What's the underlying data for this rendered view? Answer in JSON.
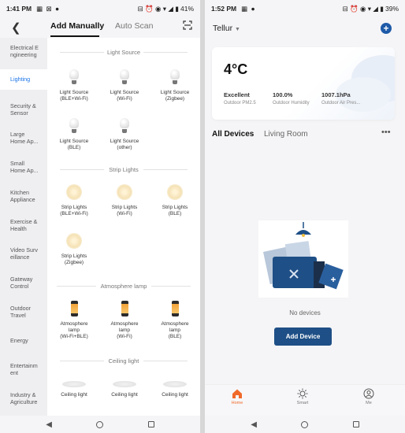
{
  "left_screen": {
    "status": {
      "time": "1:41 PM",
      "battery": "41%"
    },
    "header": {
      "tab_manual": "Add Manually",
      "tab_auto": "Auto Scan"
    },
    "sidebar": [
      {
        "label": "Electrical Engineering",
        "lines": [
          "Electrical E",
          "ngineering"
        ]
      },
      {
        "label": "Lighting"
      },
      {
        "label": "Security & Sensor",
        "lines": [
          "Security &",
          "Sensor"
        ]
      },
      {
        "label": "Large Home Ap...",
        "lines": [
          "Large",
          "Home Ap..."
        ]
      },
      {
        "label": "Small Home Ap...",
        "lines": [
          "Small",
          "Home Ap..."
        ]
      },
      {
        "label": "Kitchen Appliance",
        "lines": [
          "Kitchen",
          "Appliance"
        ]
      },
      {
        "label": "Exercise & Health",
        "lines": [
          "Exercise &",
          "Health"
        ]
      },
      {
        "label": "Video Surveillance",
        "lines": [
          "Video Surv",
          "eillance"
        ]
      },
      {
        "label": "Gateway Control",
        "lines": [
          "Gateway",
          "Control"
        ]
      },
      {
        "label": "Outdoor Travel",
        "lines": [
          "Outdoor",
          "Travel"
        ]
      },
      {
        "label": "Energy"
      },
      {
        "label": "Entertainment",
        "lines": [
          "Entertainm",
          "ent"
        ]
      },
      {
        "label": "Industry & Agriculture",
        "lines": [
          "Industry &",
          "Agriculture"
        ]
      }
    ],
    "sections": {
      "light_source": {
        "title": "Light Source",
        "devices": [
          {
            "line1": "Light Source",
            "line2": "(BLE+Wi-Fi)"
          },
          {
            "line1": "Light Source",
            "line2": "(Wi-Fi)"
          },
          {
            "line1": "Light Source",
            "line2": "(Zigbee)"
          },
          {
            "line1": "Light Source",
            "line2": "(BLE)"
          },
          {
            "line1": "Light Source",
            "line2": "(other)"
          }
        ]
      },
      "strip_lights": {
        "title": "Strip Lights",
        "devices": [
          {
            "line1": "Strip Lights",
            "line2": "(BLE+Wi-Fi)"
          },
          {
            "line1": "Strip Lights",
            "line2": "(Wi-Fi)"
          },
          {
            "line1": "Strip Lights",
            "line2": "(BLE)"
          },
          {
            "line1": "Strip Lights",
            "line2": "(Zigbee)"
          }
        ]
      },
      "atmosphere_lamp": {
        "title": "Atmosphere lamp",
        "devices": [
          {
            "line1": "Atmosphere",
            "line2": "lamp",
            "line3": "(Wi-Fi+BLE)"
          },
          {
            "line1": "Atmosphere",
            "line2": "lamp",
            "line3": "(Wi-Fi)"
          },
          {
            "line1": "Atmosphere",
            "line2": "lamp",
            "line3": "(BLE)"
          }
        ]
      },
      "ceiling_light": {
        "title": "Ceiling light",
        "devices": [
          {
            "line1": "Ceiling light"
          },
          {
            "line1": "Ceiling light"
          },
          {
            "line1": "Ceiling light"
          }
        ]
      }
    }
  },
  "right_screen": {
    "status": {
      "time": "1:52 PM",
      "battery": "39%"
    },
    "home_name": "Tellur",
    "weather": {
      "temperature": "4°C",
      "items": [
        {
          "value": "Excellent",
          "label": "Outdoor PM2.5"
        },
        {
          "value": "100.0%",
          "label": "Outdoor Humidity"
        },
        {
          "value": "1007.1hPa",
          "label": "Outdoor Air Pres..."
        }
      ]
    },
    "rooms": {
      "all": "All Devices",
      "living": "Living Room"
    },
    "empty_state": {
      "message": "No devices",
      "button": "Add Device"
    },
    "tabbar": {
      "home": "Home",
      "smart": "Smart",
      "me": "Me"
    }
  },
  "colors": {
    "accent": "#1e5aa8",
    "active_tab": "#f06a2a",
    "lighting_active": "#1a73e8",
    "add_device_bg": "#1e4f86"
  }
}
